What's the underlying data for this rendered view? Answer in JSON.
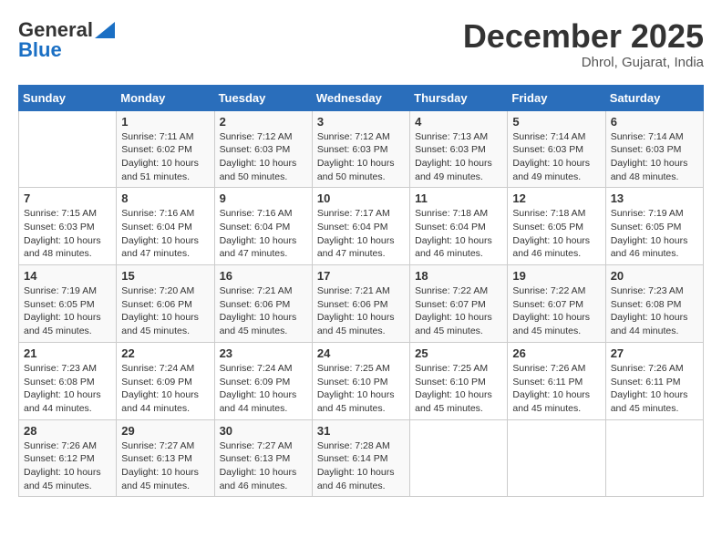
{
  "header": {
    "logo_line1": "General",
    "logo_line2": "Blue",
    "title": "December 2025",
    "subtitle": "Dhrol, Gujarat, India"
  },
  "calendar": {
    "days_of_week": [
      "Sunday",
      "Monday",
      "Tuesday",
      "Wednesday",
      "Thursday",
      "Friday",
      "Saturday"
    ],
    "weeks": [
      [
        {
          "day": "",
          "sunrise": "",
          "sunset": "",
          "daylight": ""
        },
        {
          "day": "1",
          "sunrise": "Sunrise: 7:11 AM",
          "sunset": "Sunset: 6:02 PM",
          "daylight": "Daylight: 10 hours and 51 minutes."
        },
        {
          "day": "2",
          "sunrise": "Sunrise: 7:12 AM",
          "sunset": "Sunset: 6:03 PM",
          "daylight": "Daylight: 10 hours and 50 minutes."
        },
        {
          "day": "3",
          "sunrise": "Sunrise: 7:12 AM",
          "sunset": "Sunset: 6:03 PM",
          "daylight": "Daylight: 10 hours and 50 minutes."
        },
        {
          "day": "4",
          "sunrise": "Sunrise: 7:13 AM",
          "sunset": "Sunset: 6:03 PM",
          "daylight": "Daylight: 10 hours and 49 minutes."
        },
        {
          "day": "5",
          "sunrise": "Sunrise: 7:14 AM",
          "sunset": "Sunset: 6:03 PM",
          "daylight": "Daylight: 10 hours and 49 minutes."
        },
        {
          "day": "6",
          "sunrise": "Sunrise: 7:14 AM",
          "sunset": "Sunset: 6:03 PM",
          "daylight": "Daylight: 10 hours and 48 minutes."
        }
      ],
      [
        {
          "day": "7",
          "sunrise": "Sunrise: 7:15 AM",
          "sunset": "Sunset: 6:03 PM",
          "daylight": "Daylight: 10 hours and 48 minutes."
        },
        {
          "day": "8",
          "sunrise": "Sunrise: 7:16 AM",
          "sunset": "Sunset: 6:04 PM",
          "daylight": "Daylight: 10 hours and 47 minutes."
        },
        {
          "day": "9",
          "sunrise": "Sunrise: 7:16 AM",
          "sunset": "Sunset: 6:04 PM",
          "daylight": "Daylight: 10 hours and 47 minutes."
        },
        {
          "day": "10",
          "sunrise": "Sunrise: 7:17 AM",
          "sunset": "Sunset: 6:04 PM",
          "daylight": "Daylight: 10 hours and 47 minutes."
        },
        {
          "day": "11",
          "sunrise": "Sunrise: 7:18 AM",
          "sunset": "Sunset: 6:04 PM",
          "daylight": "Daylight: 10 hours and 46 minutes."
        },
        {
          "day": "12",
          "sunrise": "Sunrise: 7:18 AM",
          "sunset": "Sunset: 6:05 PM",
          "daylight": "Daylight: 10 hours and 46 minutes."
        },
        {
          "day": "13",
          "sunrise": "Sunrise: 7:19 AM",
          "sunset": "Sunset: 6:05 PM",
          "daylight": "Daylight: 10 hours and 46 minutes."
        }
      ],
      [
        {
          "day": "14",
          "sunrise": "Sunrise: 7:19 AM",
          "sunset": "Sunset: 6:05 PM",
          "daylight": "Daylight: 10 hours and 45 minutes."
        },
        {
          "day": "15",
          "sunrise": "Sunrise: 7:20 AM",
          "sunset": "Sunset: 6:06 PM",
          "daylight": "Daylight: 10 hours and 45 minutes."
        },
        {
          "day": "16",
          "sunrise": "Sunrise: 7:21 AM",
          "sunset": "Sunset: 6:06 PM",
          "daylight": "Daylight: 10 hours and 45 minutes."
        },
        {
          "day": "17",
          "sunrise": "Sunrise: 7:21 AM",
          "sunset": "Sunset: 6:06 PM",
          "daylight": "Daylight: 10 hours and 45 minutes."
        },
        {
          "day": "18",
          "sunrise": "Sunrise: 7:22 AM",
          "sunset": "Sunset: 6:07 PM",
          "daylight": "Daylight: 10 hours and 45 minutes."
        },
        {
          "day": "19",
          "sunrise": "Sunrise: 7:22 AM",
          "sunset": "Sunset: 6:07 PM",
          "daylight": "Daylight: 10 hours and 45 minutes."
        },
        {
          "day": "20",
          "sunrise": "Sunrise: 7:23 AM",
          "sunset": "Sunset: 6:08 PM",
          "daylight": "Daylight: 10 hours and 44 minutes."
        }
      ],
      [
        {
          "day": "21",
          "sunrise": "Sunrise: 7:23 AM",
          "sunset": "Sunset: 6:08 PM",
          "daylight": "Daylight: 10 hours and 44 minutes."
        },
        {
          "day": "22",
          "sunrise": "Sunrise: 7:24 AM",
          "sunset": "Sunset: 6:09 PM",
          "daylight": "Daylight: 10 hours and 44 minutes."
        },
        {
          "day": "23",
          "sunrise": "Sunrise: 7:24 AM",
          "sunset": "Sunset: 6:09 PM",
          "daylight": "Daylight: 10 hours and 44 minutes."
        },
        {
          "day": "24",
          "sunrise": "Sunrise: 7:25 AM",
          "sunset": "Sunset: 6:10 PM",
          "daylight": "Daylight: 10 hours and 45 minutes."
        },
        {
          "day": "25",
          "sunrise": "Sunrise: 7:25 AM",
          "sunset": "Sunset: 6:10 PM",
          "daylight": "Daylight: 10 hours and 45 minutes."
        },
        {
          "day": "26",
          "sunrise": "Sunrise: 7:26 AM",
          "sunset": "Sunset: 6:11 PM",
          "daylight": "Daylight: 10 hours and 45 minutes."
        },
        {
          "day": "27",
          "sunrise": "Sunrise: 7:26 AM",
          "sunset": "Sunset: 6:11 PM",
          "daylight": "Daylight: 10 hours and 45 minutes."
        }
      ],
      [
        {
          "day": "28",
          "sunrise": "Sunrise: 7:26 AM",
          "sunset": "Sunset: 6:12 PM",
          "daylight": "Daylight: 10 hours and 45 minutes."
        },
        {
          "day": "29",
          "sunrise": "Sunrise: 7:27 AM",
          "sunset": "Sunset: 6:13 PM",
          "daylight": "Daylight: 10 hours and 45 minutes."
        },
        {
          "day": "30",
          "sunrise": "Sunrise: 7:27 AM",
          "sunset": "Sunset: 6:13 PM",
          "daylight": "Daylight: 10 hours and 46 minutes."
        },
        {
          "day": "31",
          "sunrise": "Sunrise: 7:28 AM",
          "sunset": "Sunset: 6:14 PM",
          "daylight": "Daylight: 10 hours and 46 minutes."
        },
        {
          "day": "",
          "sunrise": "",
          "sunset": "",
          "daylight": ""
        },
        {
          "day": "",
          "sunrise": "",
          "sunset": "",
          "daylight": ""
        },
        {
          "day": "",
          "sunrise": "",
          "sunset": "",
          "daylight": ""
        }
      ]
    ]
  }
}
